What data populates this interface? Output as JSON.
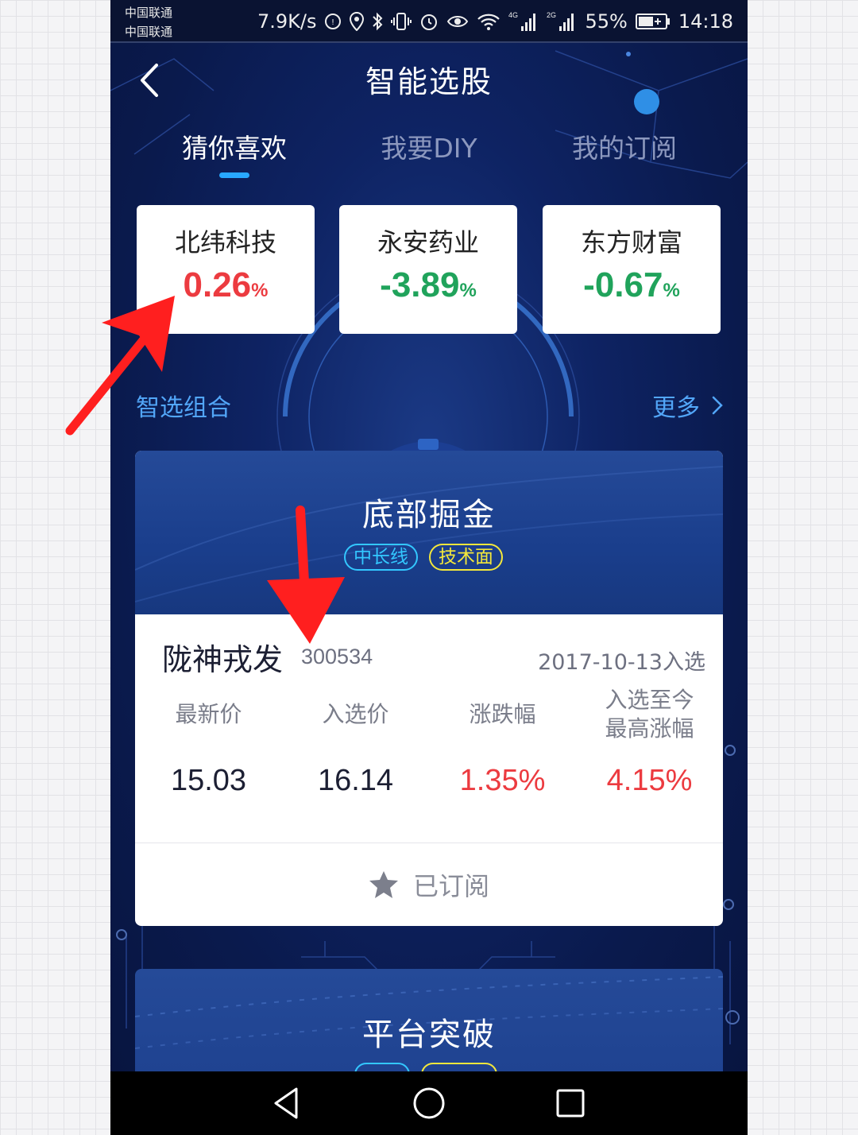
{
  "status_bar": {
    "carrier_1": "中国联通",
    "carrier_2": "中国联通",
    "net_speed": "7.9K/s",
    "signal_1_label": "4G",
    "signal_2_label": "2G",
    "battery": "55%",
    "time": "14:18"
  },
  "header": {
    "title": "智能选股",
    "back_icon": "chevron-left-icon"
  },
  "tabs": [
    {
      "label": "猜你喜欢",
      "active": true
    },
    {
      "label": "我要DIY",
      "active": false
    },
    {
      "label": "我的订阅",
      "active": false
    }
  ],
  "stock_cards": [
    {
      "name": "北纬科技",
      "change": "0.26",
      "unit": "%",
      "color": "#ec3b40"
    },
    {
      "name": "永安药业",
      "change": "-3.89",
      "unit": "%",
      "color": "#20a35b"
    },
    {
      "name": "东方财富",
      "change": "-0.67",
      "unit": "%",
      "color": "#20a35b"
    }
  ],
  "section": {
    "label": "智选组合",
    "more": "更多"
  },
  "strategy": {
    "title": "底部掘金",
    "tags": [
      "中长线",
      "技术面"
    ],
    "stock_name": "陇神戎发",
    "stock_code": "300534",
    "pick_date": "2017-10-13入选",
    "metrics": [
      {
        "label": "最新价",
        "value": "15.03"
      },
      {
        "label": "入选价",
        "value": "16.14"
      },
      {
        "label": "涨跌幅",
        "value": "1.35%"
      },
      {
        "label": "入选至今\n最高涨幅",
        "value": "4.15%"
      }
    ],
    "subscribe_label": "已订阅"
  },
  "strategy_2": {
    "title": "平台突破"
  },
  "colors": {
    "accent_blue": "#28a8ff",
    "link_blue": "#52a6f8",
    "up_red": "#ec3b40",
    "down_green": "#20a35b",
    "annotation_red": "#ff1f1f"
  }
}
